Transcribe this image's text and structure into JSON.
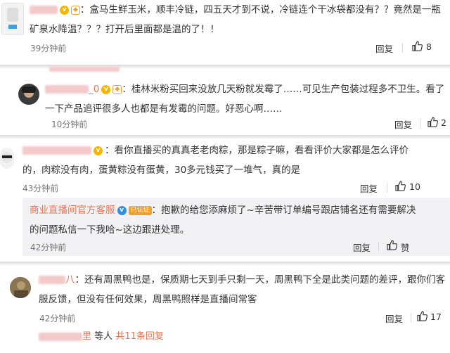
{
  "comments": [
    {
      "line1": "盒马生鲜玉米，顺丰冷链，四五天才到不说，冷链连个干冰袋都没有？？竟然是一瓶",
      "line2": "矿泉水降温？？？打开后里面都是温的了！！",
      "time": "39分钟前",
      "reply": "回复",
      "likes": "8"
    },
    {
      "username_suffix": "_0",
      "line1": "桂林米粉买回来没放几天粉就发霉了……可见生产包装过程多不卫生。看了",
      "line2": "一下产品追评很多人也都是有发霉的问题。好恶心啊……",
      "time": "10分钟前",
      "reply": "回复",
      "likes": "2"
    },
    {
      "line1": "看你直播买的真真老老肉粽，那是粽子嘛，看看评价大家都是怎么评价",
      "line2": "的，肉粽没有肉，蛋黄粽没有蛋黄，30多元钱买了一堆气，真的是",
      "time": "43分钟前",
      "reply": "回复",
      "likes": "10"
    },
    {
      "username": "商业直播间官方客服",
      "badge": "已认证",
      "line1": "抱歉的给您添麻烦了~辛苦带订单编号跟店铺名还有需要解决",
      "line2": "的问题私信一下我哈~这边跟进处理。",
      "time": "42分钟前",
      "reply": "回复",
      "likes": "赞"
    },
    {
      "line1": "还有周黑鸭也是，保质期七天到手只剩一天，周黑鸭下全是此类问题的差评，跟你们客",
      "line2": "服反馈，但没有任何效果，周黑鸭照样是直播间常客",
      "time": "42分钟前",
      "reply": "回复",
      "likes": "17"
    }
  ],
  "footer": {
    "name_suffix": "里",
    "others": "等人",
    "more": "共11条回复"
  }
}
